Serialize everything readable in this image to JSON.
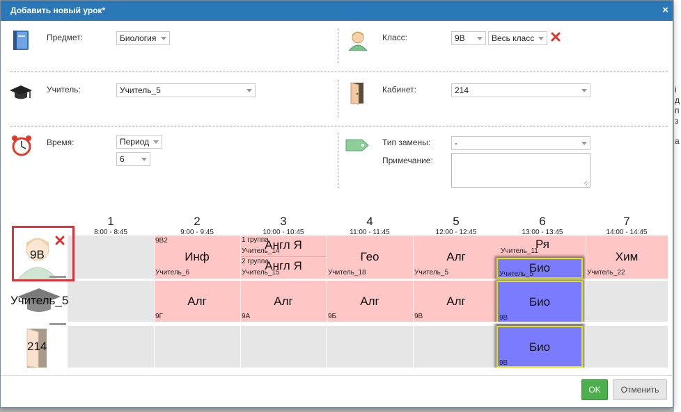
{
  "dialog": {
    "title": "Добавить новый урок*",
    "close": "×"
  },
  "form": {
    "subject": {
      "label": "Предмет:",
      "value": "Биология"
    },
    "class": {
      "label": "Класс:",
      "value": "9В",
      "group": "Весь класс"
    },
    "teacher": {
      "label": "Учитель:",
      "value": "Учитель_5"
    },
    "room": {
      "label": "Кабинет:",
      "value": "214"
    },
    "time": {
      "label": "Время:",
      "mode": "Период",
      "period": "6"
    },
    "replacement": {
      "label": "Тип замены:",
      "value": "-"
    },
    "note": {
      "label": "Примечание:",
      "value": ""
    }
  },
  "timetable": {
    "periods": [
      {
        "num": "1",
        "time": "8:00 - 8:45"
      },
      {
        "num": "2",
        "time": "9:00 - 9:45"
      },
      {
        "num": "3",
        "time": "10:00 - 10:45"
      },
      {
        "num": "4",
        "time": "11:00 - 11:45"
      },
      {
        "num": "5",
        "time": "12:00 - 12:45"
      },
      {
        "num": "6",
        "time": "13:00 - 13:45"
      },
      {
        "num": "7",
        "time": "14:00 - 14:45"
      }
    ],
    "rows": {
      "class": {
        "label": "9В"
      },
      "teacher": {
        "label": "Учитель_5"
      },
      "room": {
        "label": "214"
      }
    },
    "class_row": {
      "p2": {
        "subject": "Инф",
        "group": "9В2",
        "teacher": "Учитель_6"
      },
      "p3": {
        "g1_label": "1 группа",
        "g1_teacher": "Учитель_14",
        "g1_subject": "Англ Я",
        "g2_label": "2 группа",
        "g2_teacher": "Учитель_15",
        "g2_subject": "Англ Я"
      },
      "p4": {
        "subject": "Гео",
        "teacher": "Учитель_18"
      },
      "p5": {
        "subject": "Алг",
        "teacher": "Учитель_5"
      },
      "p6": {
        "subject": "Ря",
        "teacher": "Учитель_11",
        "new_subject": "Био",
        "new_teacher": "Учитель_5"
      },
      "p7": {
        "subject": "Хим",
        "teacher": "Учитель_22"
      }
    },
    "teacher_row": {
      "p2": {
        "subject": "Алг",
        "class": "9Г"
      },
      "p3": {
        "subject": "Алг",
        "class": "9А"
      },
      "p4": {
        "subject": "Алг",
        "class": "9Б"
      },
      "p5": {
        "subject": "Алг",
        "class": "9В"
      },
      "p6": {
        "subject": "Био",
        "class": "9В"
      }
    },
    "room_row": {
      "p6": {
        "subject": "Био",
        "class": "9В"
      }
    }
  },
  "buttons": {
    "ok": "OK",
    "cancel": "Отменить"
  },
  "backdrop": {
    "chars": [
      "і",
      "д",
      "п",
      "з",
      "а"
    ]
  }
}
